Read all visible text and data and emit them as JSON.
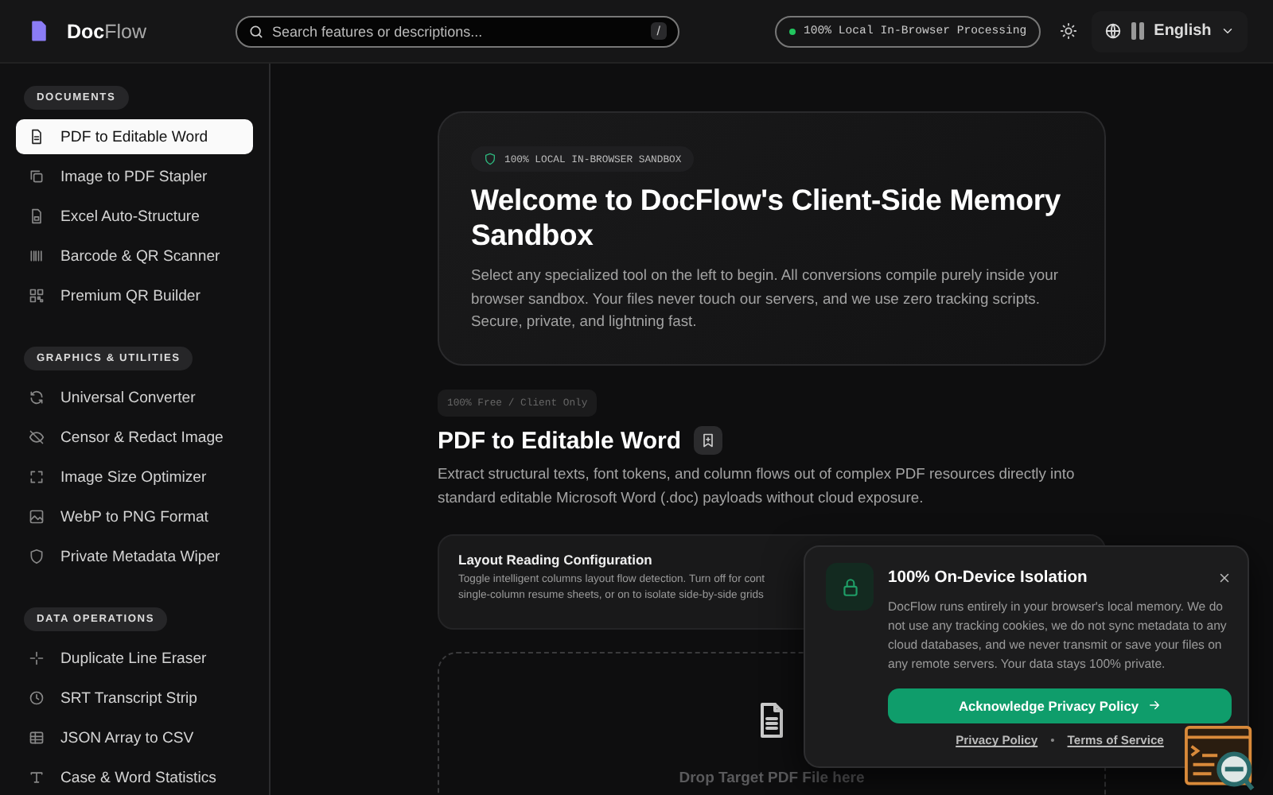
{
  "header": {
    "logo": "**Doc**Flow",
    "search": {
      "placeholder": "Search features or descriptions...",
      "shortcut": "/"
    },
    "status": "100% Local In-Browser Processing",
    "language": "English"
  },
  "sidebar": {
    "sections": [
      {
        "title": "DOCUMENTS",
        "items": [
          {
            "label": "PDF to Editable Word",
            "selected": true
          },
          {
            "label": "Image to PDF Stapler",
            "selected": false
          },
          {
            "label": "Excel Auto-Structure",
            "selected": false
          },
          {
            "label": "Barcode & QR Scanner",
            "selected": false
          },
          {
            "label": "Premium QR Builder",
            "selected": false
          }
        ]
      },
      {
        "title": "GRAPHICS & UTILITIES",
        "items": [
          {
            "label": "Universal Converter",
            "selected": false
          },
          {
            "label": "Censor & Redact Image",
            "selected": false
          },
          {
            "label": "Image Size Optimizer",
            "selected": false
          },
          {
            "label": "WebP to PNG Format",
            "selected": false
          },
          {
            "label": "Private Metadata Wiper",
            "selected": false
          }
        ]
      },
      {
        "title": "DATA OPERATIONS",
        "items": [
          {
            "label": "Duplicate Line Eraser",
            "selected": false
          },
          {
            "label": "SRT Transcript Strip",
            "selected": false
          },
          {
            "label": "JSON Array to CSV",
            "selected": false
          },
          {
            "label": "Case & Word Statistics",
            "selected": false
          }
        ]
      }
    ]
  },
  "hero": {
    "badge": "100% LOCAL IN-BROWSER SANDBOX",
    "title": "Welcome to DocFlow's Client-Side Memory Sandbox",
    "text": "Select any specialized tool on the left to begin. All conversions compile purely inside your browser sandbox. Your files never touch our servers, and we use zero tracking scripts. Secure, private, and lightning fast."
  },
  "tool": {
    "badge": "100% Free / Client Only",
    "title": "PDF to Editable Word",
    "description": "Extract structural texts, font tokens, and column flows out of complex PDF resources directly into standard editable Microsoft Word (.doc) payloads without cloud exposure.",
    "config": {
      "title": "Layout Reading Configuration",
      "lines": [
        "Toggle intelligent columns layout flow detection. Turn off for cont",
        "single-column resume sheets, or on to isolate side-by-side grids"
      ]
    },
    "dropzone": {
      "title": "Drop Target PDF File here"
    }
  },
  "privacy_popup": {
    "title": "100% On-Device Isolation",
    "text": "DocFlow runs entirely in your browser's local memory. We do not use any tracking cookies, we do not sync metadata to any cloud databases, and we never transmit or save your files on any remote servers. Your data stays 100% private.",
    "button": "Acknowledge Privacy Policy",
    "links": [
      "Privacy Policy",
      "Terms of Service"
    ],
    "separator": "•"
  }
}
